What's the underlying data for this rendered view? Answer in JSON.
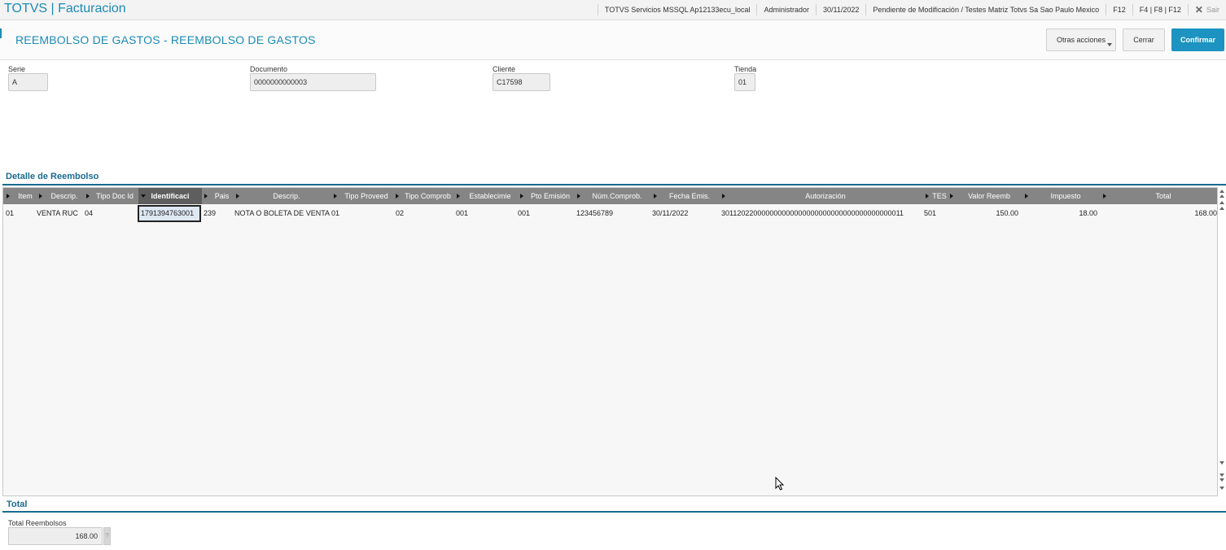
{
  "app": {
    "title": "TOTVS | Facturacion"
  },
  "topbar": {
    "server": "TOTVS Servicios MSSQL Ap12133ecu_local",
    "user": "Administrador",
    "date": "30/11/2022",
    "status": "Pendiente de Modificación / Testes Matriz Totvs Sa Sao Paulo Mexico",
    "key_f12": "F12",
    "keys": "F4 | F8 | F12",
    "exit_label": "Sair"
  },
  "header": {
    "title": "REEMBOLSO DE GASTOS - REEMBOLSO DE GASTOS",
    "otras_label": "Otras acciones",
    "cerrar_label": "Cerrar",
    "confirmar_label": "Confirmar"
  },
  "fields": {
    "serie": {
      "label": "Serie",
      "value": "A"
    },
    "documento": {
      "label": "Documento",
      "value": "0000000000003"
    },
    "cliente": {
      "label": "Cliente",
      "value": "C17598"
    },
    "tienda": {
      "label": "Tienda",
      "value": "01"
    }
  },
  "detalle": {
    "title": "Detalle de Reembolso",
    "columns": [
      "Item",
      "Descrip.",
      "Tipo Doc Id",
      "Identificaci",
      "Pais",
      "Descrip.",
      "Tipo Proveed",
      "Tipo Comprob",
      "Establecimie",
      "Pto Emisión",
      "Núm.Comprob.",
      "Fecha Emis.",
      "Autorización",
      "TES",
      "Valor Reemb",
      "Impuesto",
      "Total"
    ],
    "rows": [
      [
        "01",
        "VENTA RUC",
        "04",
        "1791394763001",
        "239",
        "NOTA O BOLETA DE VENTA",
        "01",
        "02",
        "001",
        "001",
        "123456789",
        "30/11/2022",
        "301120220000000000000000000000000000000000011",
        "501",
        "150.00",
        "18.00",
        "168.00"
      ]
    ]
  },
  "total": {
    "title": "Total",
    "label": "Total Reembolsos",
    "value": "168.00",
    "help": "?"
  },
  "colors": {
    "accent": "#1c8bb4",
    "button_primary": "#1c93c0",
    "grid_header": "#858585"
  }
}
